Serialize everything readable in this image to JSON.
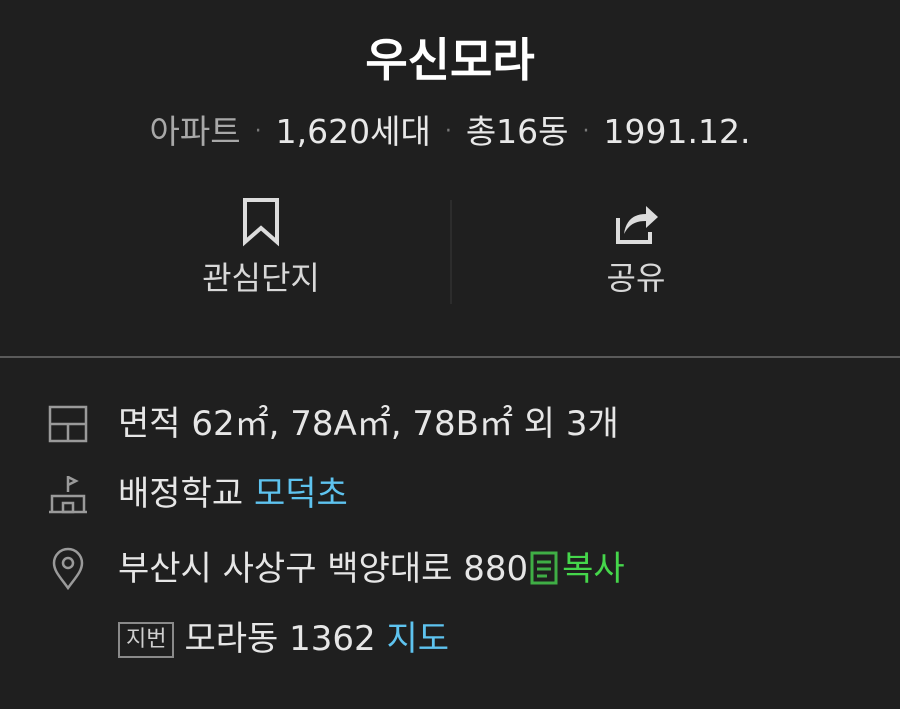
{
  "complex": {
    "name": "우신모라",
    "type": "아파트",
    "households": "1,620세대",
    "buildings": "총16동",
    "built": "1991.12."
  },
  "actions": {
    "bookmark_label": "관심단지",
    "share_label": "공유"
  },
  "info": {
    "area_text": "면적 62㎡, 78A㎡, 78B㎡ 외 3개",
    "school_prefix": "배정학교",
    "school_name": "모덕초",
    "address": "부산시 사상구 백양대로 880",
    "copy_label": "복사",
    "lot_badge": "지번",
    "lot_address": "모라동 1362",
    "map_label": "지도"
  },
  "icons": {
    "bookmark": "bookmark-icon",
    "share": "share-icon",
    "area": "floorplan-icon",
    "school": "school-flag-icon",
    "location": "location-pin-icon",
    "copy": "copy-icon"
  },
  "colors": {
    "background": "#1f1f1f",
    "link_blue": "#5ec3ef",
    "link_green": "#45d64b"
  }
}
